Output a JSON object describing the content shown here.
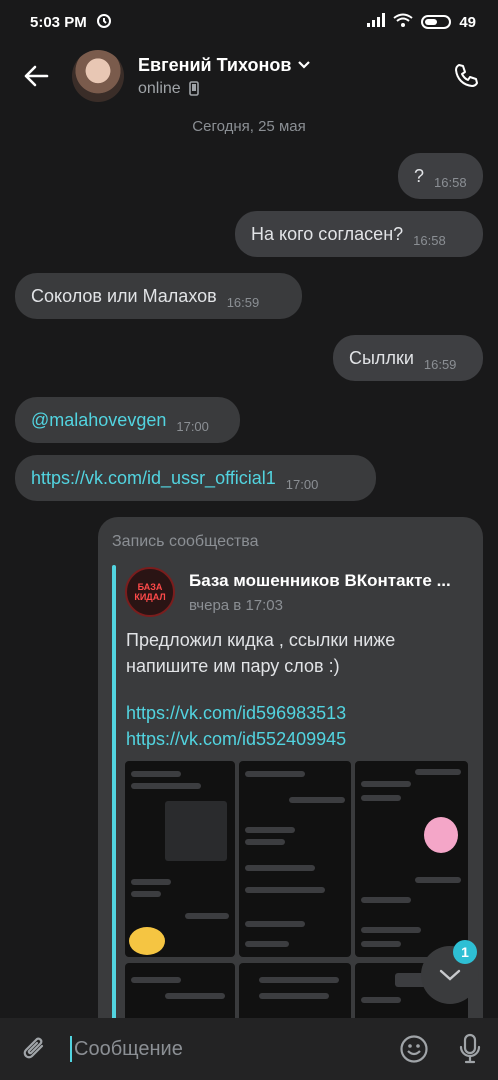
{
  "status": {
    "time": "5:03 PM",
    "battery": "49"
  },
  "header": {
    "name": "Евгений Тихонов",
    "status": "online"
  },
  "date_separator": "Сегодня, 25 мая",
  "messages": [
    {
      "text": "?",
      "time": "16:58"
    },
    {
      "text": "На кого согласен?",
      "time": "16:58"
    },
    {
      "text": "Соколов или Малахов",
      "time": "16:59"
    },
    {
      "text": "Сыллки",
      "time": "16:59"
    },
    {
      "text": "@malahovevgen",
      "time": "17:00"
    },
    {
      "text": "https://vk.com/id_ussr_official1",
      "time": "17:00"
    }
  ],
  "post": {
    "caption": "Запись сообщества",
    "group_name": "База мошенников ВКонтакте ...",
    "group_avatar_text": "БАЗА КИДАЛ",
    "time": "вчера в 17:03",
    "text": "Предложил кидка , ссылки ниже напишите им пару слов :)",
    "links": [
      "https://vk.com/id596983513",
      "https://vk.com/id552409945"
    ]
  },
  "fab": {
    "badge": "1"
  },
  "composer": {
    "placeholder": "Сообщение"
  },
  "colors": {
    "accent": "#52d4e0",
    "bubble": "#3a3b3d",
    "background": "#19191a"
  }
}
